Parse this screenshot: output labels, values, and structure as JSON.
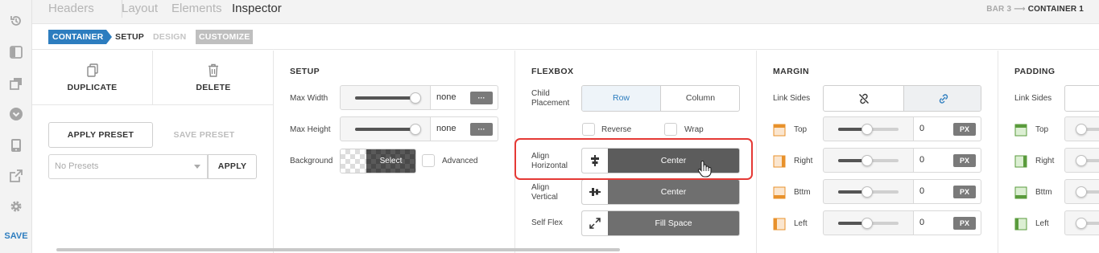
{
  "topnav": {
    "tabs": [
      "Headers",
      "Layout",
      "Elements",
      "Inspector"
    ],
    "breadcrumb": {
      "parent": "BAR 3",
      "arrow": "⟶",
      "current": "CONTAINER 1"
    }
  },
  "subtabs": {
    "container": "CONTAINER",
    "setup": "SETUP",
    "design": "DESIGN",
    "customize": "CUSTOMIZE"
  },
  "rail": {
    "icons": [
      "history-icon",
      "panel-icon",
      "layers-icon",
      "chevron-circle-icon",
      "device-icon",
      "external-link-icon",
      "gear-icon"
    ],
    "save_label": "SAVE"
  },
  "actions": {
    "duplicate": "DUPLICATE",
    "delete": "DELETE",
    "apply_preset": "APPLY PRESET",
    "save_preset": "SAVE PRESET",
    "preset_placeholder": "No Presets",
    "apply": "APPLY"
  },
  "setup": {
    "heading": "SETUP",
    "max_width": {
      "label": "Max Width",
      "value": "none",
      "more": "···",
      "level": 1.0
    },
    "max_height": {
      "label": "Max Height",
      "value": "none",
      "more": "···",
      "level": 1.0
    },
    "background": {
      "label": "Background",
      "select": "Select",
      "advanced": "Advanced"
    }
  },
  "flexbox": {
    "heading": "FLEXBOX",
    "child_placement": {
      "label": "Child Placement",
      "options": [
        "Row",
        "Column"
      ],
      "selected": "Row"
    },
    "reverse": "Reverse",
    "wrap": "Wrap",
    "align_horizontal": {
      "label": "Align Horizontal",
      "value": "Center"
    },
    "align_vertical": {
      "label": "Align Vertical",
      "value": "Center"
    },
    "self_flex": {
      "label": "Self Flex",
      "value": "Fill Space"
    }
  },
  "margin": {
    "heading": "MARGIN",
    "link_sides": "Link Sides",
    "sides": [
      {
        "label": "Top",
        "value": "0",
        "unit": "PX"
      },
      {
        "label": "Right",
        "value": "0",
        "unit": "PX"
      },
      {
        "label": "Bttm",
        "value": "0",
        "unit": "PX"
      },
      {
        "label": "Left",
        "value": "0",
        "unit": "PX"
      }
    ],
    "accent": "#e8912b"
  },
  "padding": {
    "heading": "PADDING",
    "link_sides": "Link Sides",
    "sides": [
      {
        "label": "Top"
      },
      {
        "label": "Right"
      },
      {
        "label": "Bttm"
      },
      {
        "label": "Left"
      }
    ],
    "accent": "#5a9b3c"
  },
  "colors": {
    "accent_blue": "#2d7dbf",
    "highlight": "#e53935"
  }
}
